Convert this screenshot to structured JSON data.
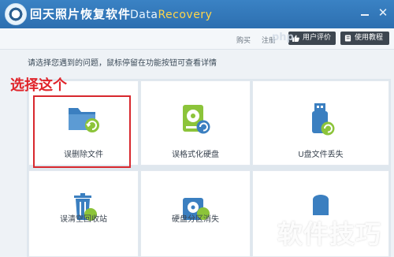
{
  "window": {
    "title": "回天照片恢复软件",
    "brand_part1": "Data",
    "brand_part2": "Recovery",
    "minimize_glyph": "",
    "close_glyph": "✕"
  },
  "toolbar": {
    "buy": "购买",
    "login": "注册",
    "review_button": "用户评价",
    "guide_button": "使用教程"
  },
  "main": {
    "prompt": "请选择您遇到的问题，鼠标停留在功能按钮可查看详情",
    "annotation": "选择这个"
  },
  "tiles": [
    {
      "label": "误删除文件",
      "icon": "folder-recover-icon"
    },
    {
      "label": "误格式化硬盘",
      "icon": "hard-disk-icon"
    },
    {
      "label": "U盘文件丢失",
      "icon": "usb-drive-icon"
    },
    {
      "label": "误清空回收站",
      "icon": "recycle-bin-icon"
    },
    {
      "label": "硬盘分区消失",
      "icon": "partition-disk-icon"
    },
    {
      "label": "",
      "icon": "disk-icon"
    }
  ],
  "overlay": {
    "watermark": "软件技巧",
    "site_mark": "php"
  },
  "colors": {
    "titlebar": "#2d6fb0",
    "accent_blue": "#3b7fc0",
    "accent_green": "#8cc43a",
    "annotation_red": "#e0242a"
  }
}
